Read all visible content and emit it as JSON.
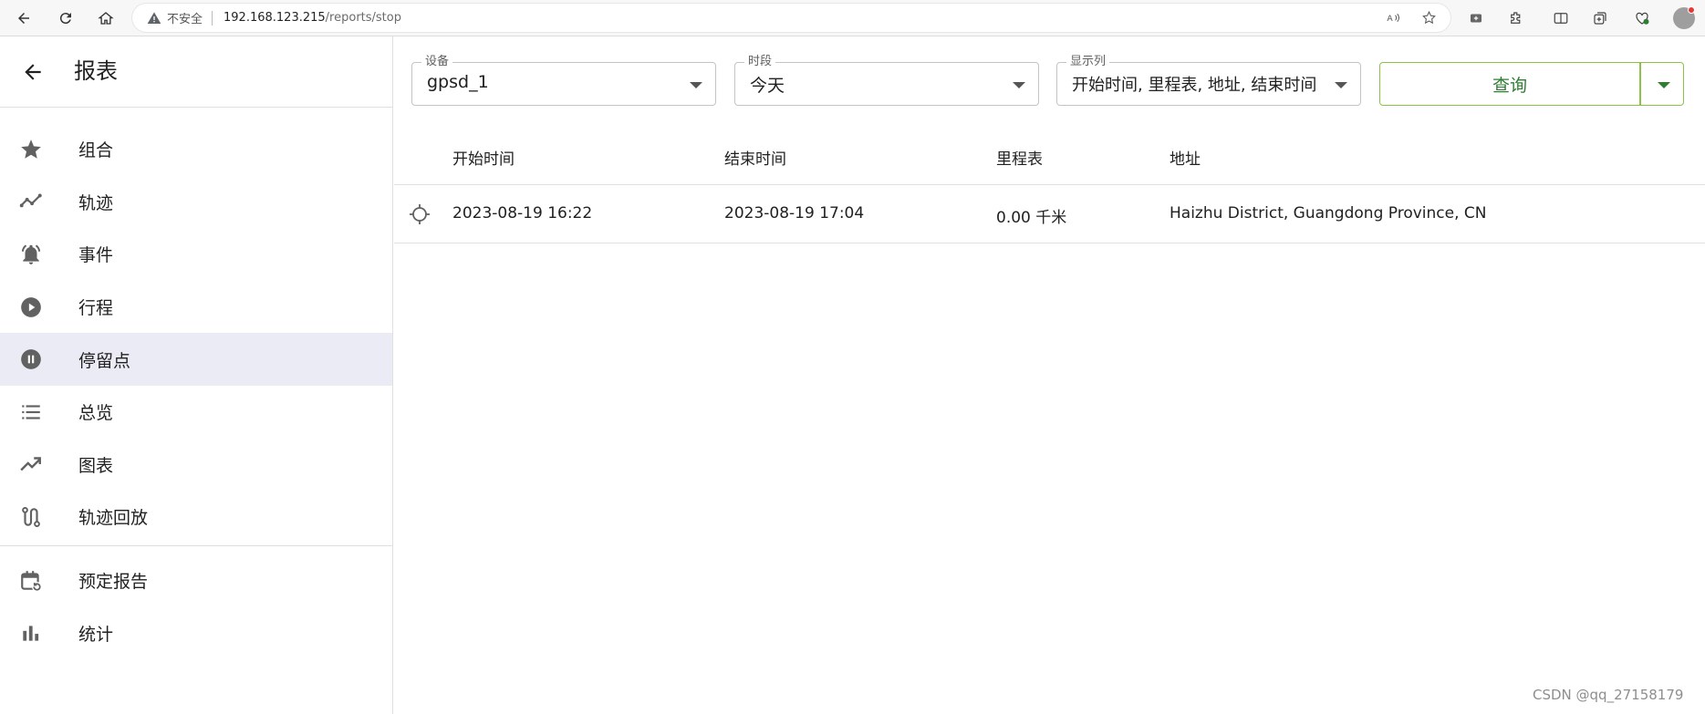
{
  "browser": {
    "insecure_label": "不安全",
    "url_host": "192.168.123.215",
    "url_path": "/reports/stop"
  },
  "sidebar": {
    "title": "报表",
    "items": [
      {
        "label": "组合",
        "icon": "star-icon"
      },
      {
        "label": "轨迹",
        "icon": "timeline-icon"
      },
      {
        "label": "事件",
        "icon": "notifications-active-icon"
      },
      {
        "label": "行程",
        "icon": "play-circle-icon"
      },
      {
        "label": "停留点",
        "icon": "pause-circle-icon",
        "active": true
      },
      {
        "label": "总览",
        "icon": "list-icon"
      },
      {
        "label": "图表",
        "icon": "trending-up-icon"
      },
      {
        "label": "轨迹回放",
        "icon": "route-icon"
      }
    ],
    "items2": [
      {
        "label": "预定报告",
        "icon": "event-repeat-icon"
      },
      {
        "label": "统计",
        "icon": "bar-chart-icon"
      }
    ]
  },
  "filters": {
    "device": {
      "label": "设备",
      "value": "gpsd_1"
    },
    "period": {
      "label": "时段",
      "value": "今天"
    },
    "columns": {
      "label": "显示列",
      "value": "开始时间, 里程表, 地址, 结束时间"
    },
    "query_label": "查询"
  },
  "table": {
    "headers": [
      "开始时间",
      "结束时间",
      "里程表",
      "地址"
    ],
    "rows": [
      {
        "start": "2023-08-19 16:22",
        "end": "2023-08-19 17:04",
        "odometer": "0.00 千米",
        "address": "Haizhu District, Guangdong Province, CN"
      }
    ]
  },
  "watermark": "CSDN @qq_27158179"
}
